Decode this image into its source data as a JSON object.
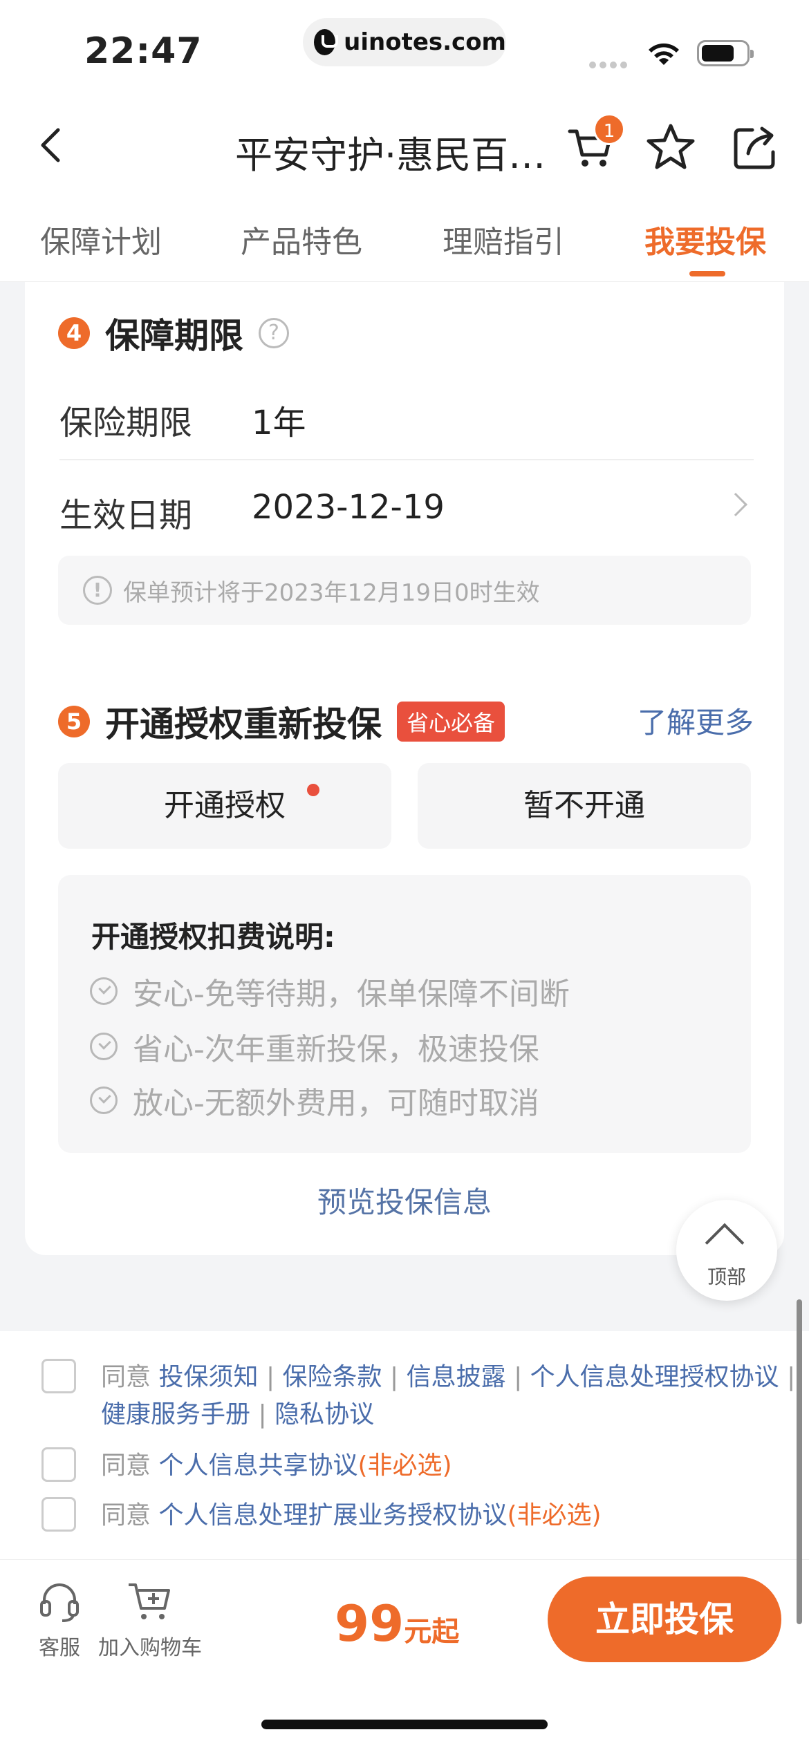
{
  "status": {
    "time": "22:47",
    "url": "uinotes.com"
  },
  "nav": {
    "title": "平安守护·惠民百…",
    "cart_count": "1"
  },
  "tabs": [
    {
      "label": "保障计划"
    },
    {
      "label": "产品特色"
    },
    {
      "label": "理赔指引"
    },
    {
      "label": "我要投保"
    }
  ],
  "section4": {
    "num": "4",
    "title": "保障期限",
    "help": "?",
    "term_label": "保险期限",
    "term_value": "1年",
    "date_label": "生效日期",
    "date_value": "2023-12-19",
    "notice": "保单预计将于2023年12月19日0时生效"
  },
  "section5": {
    "num": "5",
    "title": "开通授权重新投保",
    "tag": "省心必备",
    "more": "了解更多",
    "option_enable": "开通授权",
    "option_skip": "暂不开通",
    "explain_title": "开通授权扣费说明:",
    "explain_items": [
      "安心-免等待期，保单保障不间断",
      "省心-次年重新投保，极速投保",
      "放心-无额外费用，可随时取消"
    ],
    "preview": "预览投保信息"
  },
  "totop": {
    "label": "顶部"
  },
  "agreements": {
    "agree": "同意",
    "row1_links": [
      "投保须知",
      "保险条款",
      "信息披露",
      "个人信息处理授权协议",
      "健康服务手册",
      "隐私协议"
    ],
    "row2_link": "个人信息共享协议",
    "row3_link": "个人信息处理扩展业务授权协议",
    "optional": "(非必选)"
  },
  "bottom": {
    "service": "客服",
    "add_cart": "加入购物车",
    "price": "99",
    "price_unit": "元起",
    "buy": "立即投保"
  },
  "colors": {
    "accent": "#ee6b2a",
    "link": "#4a6dab",
    "tag": "#e9503d"
  }
}
